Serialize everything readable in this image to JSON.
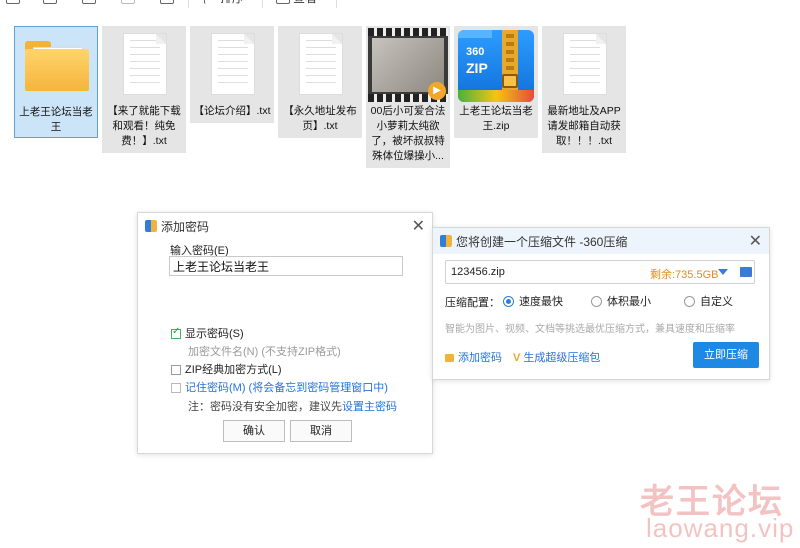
{
  "toolbar": {
    "sort_label": "排序",
    "view_label": "查看",
    "more_label": "···"
  },
  "files": [
    {
      "name": "上老王论坛当老王",
      "type": "folder",
      "selected": true
    },
    {
      "name": "【来了就能下载和观看！纯免费！】.txt",
      "type": "txt"
    },
    {
      "name": "【论坛介绍】.txt",
      "type": "txt"
    },
    {
      "name": "【永久地址发布页】.txt",
      "type": "txt"
    },
    {
      "name": "00后小可爱合法小萝莉太纯欲了，被坏叔叔特殊体位爆操小...",
      "type": "video"
    },
    {
      "name": "上老王论坛当老王.zip",
      "type": "zip"
    },
    {
      "name": "最新地址及APP请发邮箱自动获取！！！.txt",
      "type": "txt"
    }
  ],
  "zip_icon": {
    "line1": "360",
    "line2": "ZIP"
  },
  "add_password_dialog": {
    "title": "添加密码",
    "password_label": "输入密码(E)",
    "password_value": "上老王论坛当老王",
    "show_password": "显示密码(S)",
    "encrypt_filename": "加密文件名(N) (不支持ZIP格式)",
    "zip_classic": "ZIP经典加密方式(L)",
    "remember_password": "记住密码(M) (将会备忘到密码管理窗口中)",
    "note_prefix": "注：密码没有安全加密，建议先",
    "note_link": "设置主密码",
    "ok": "确认",
    "cancel": "取消"
  },
  "compress_dialog": {
    "title": "您将创建一个压缩文件 -360压缩",
    "filename": "123456.zip",
    "remaining": "剩余:735.5GB",
    "config_label": "压缩配置：",
    "options": [
      "速度最快",
      "体积最小",
      "自定义"
    ],
    "selected_option": "速度最快",
    "hint": "智能为图片、视频、文档等挑选最优压缩方式，兼具速度和压缩率",
    "add_password": "添加密码",
    "generate_super": "生成超级压缩包",
    "compress_now": "立即压缩"
  },
  "watermark": {
    "line1": "老王论坛",
    "line2": "laowang.vip"
  },
  "colors": {
    "accent": "#1e88e5",
    "remaining": "#e58b1c",
    "link": "#2573d9",
    "check": "#45b35a"
  }
}
